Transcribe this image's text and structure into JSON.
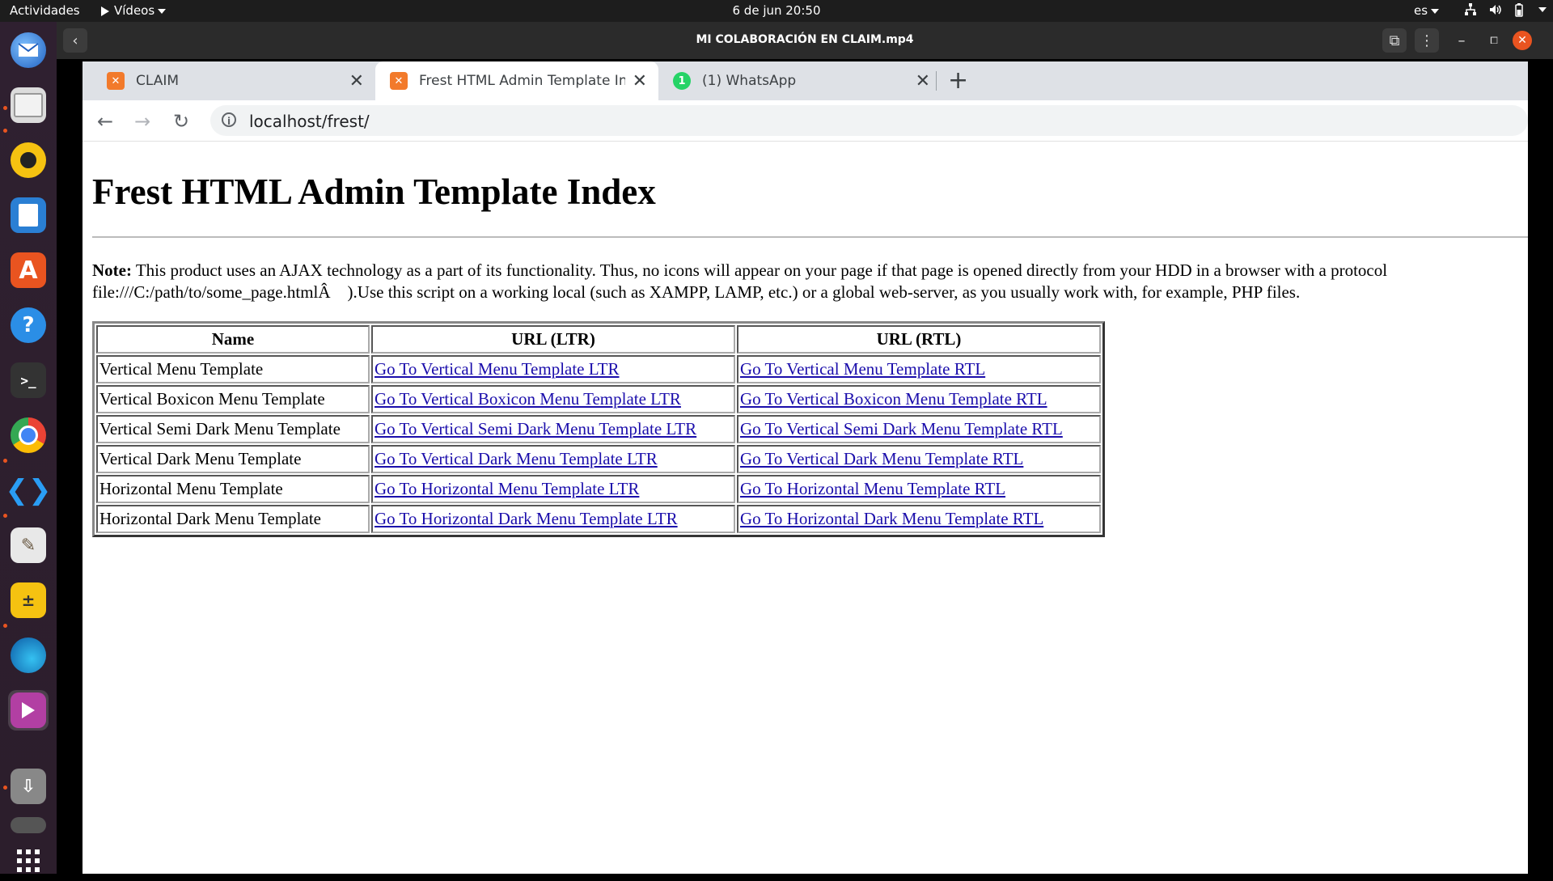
{
  "topbar": {
    "activities": "Actividades",
    "app_menu": "Vídeos",
    "clock": "6 de jun  20:50",
    "language": "es"
  },
  "dock": {
    "apps": [
      "thunderbird-icon",
      "files-icon",
      "rhythmbox-icon",
      "writer-icon",
      "software-icon",
      "help-icon",
      "terminal-icon",
      "chrome-icon",
      "vscode-icon",
      "gimp-icon",
      "calculator-icon",
      "edge-icon",
      "videos-icon",
      "usb-drive-icon",
      "drive-icon",
      "app-grid-icon"
    ]
  },
  "player": {
    "title": "MI COLABORACIÓN EN CLAIM.mp4"
  },
  "browser": {
    "tabs": [
      {
        "title": "CLAIM",
        "active": false
      },
      {
        "title": "Frest HTML Admin Template Inde",
        "active": true
      },
      {
        "title": "(1) WhatsApp",
        "active": false
      }
    ],
    "address": "localhost/frest/",
    "whatsapp_badge": "1"
  },
  "page": {
    "heading": "Frest HTML Admin Template Index",
    "note_label": "Note:",
    "note_line1": " This product uses an AJAX technology as a part of its functionality. Thus, no icons will appear on your page if that page is opened directly from your HDD in a browser with a protocol",
    "note_line2": "file:///C:/path/to/some_page.htmlÂ ).Use this script on a working local (such as XAMPP, LAMP, etc.) or a global web-server, as you usually work with, for example, PHP files.",
    "table": {
      "headers": [
        "Name",
        "URL (LTR)",
        "URL (RTL)"
      ],
      "rows": [
        {
          "name": "Vertical Menu Template",
          "ltr": "Go To Vertical Menu Template LTR",
          "rtl": "Go To Vertical Menu Template RTL"
        },
        {
          "name": "Vertical Boxicon Menu Template",
          "ltr": "Go To Vertical Boxicon Menu Template LTR",
          "rtl": "Go To Vertical Boxicon Menu Template RTL"
        },
        {
          "name": "Vertical Semi Dark Menu Template",
          "ltr": "Go To Vertical Semi Dark Menu Template LTR",
          "rtl": "Go To Vertical Semi Dark Menu Template RTL"
        },
        {
          "name": "Vertical Dark Menu Template",
          "ltr": "Go To Vertical Dark Menu Template LTR",
          "rtl": "Go To Vertical Dark Menu Template RTL"
        },
        {
          "name": "Horizontal Menu Template",
          "ltr": "Go To Horizontal Menu Template LTR",
          "rtl": "Go To Horizontal Menu Template RTL"
        },
        {
          "name": "Horizontal Dark Menu Template",
          "ltr": "Go To Horizontal Dark Menu Template LTR",
          "rtl": "Go To Horizontal Dark Menu Template RTL"
        }
      ]
    }
  },
  "colors": {
    "ubuntu_orange": "#e95420",
    "link": "#1a0dab"
  }
}
